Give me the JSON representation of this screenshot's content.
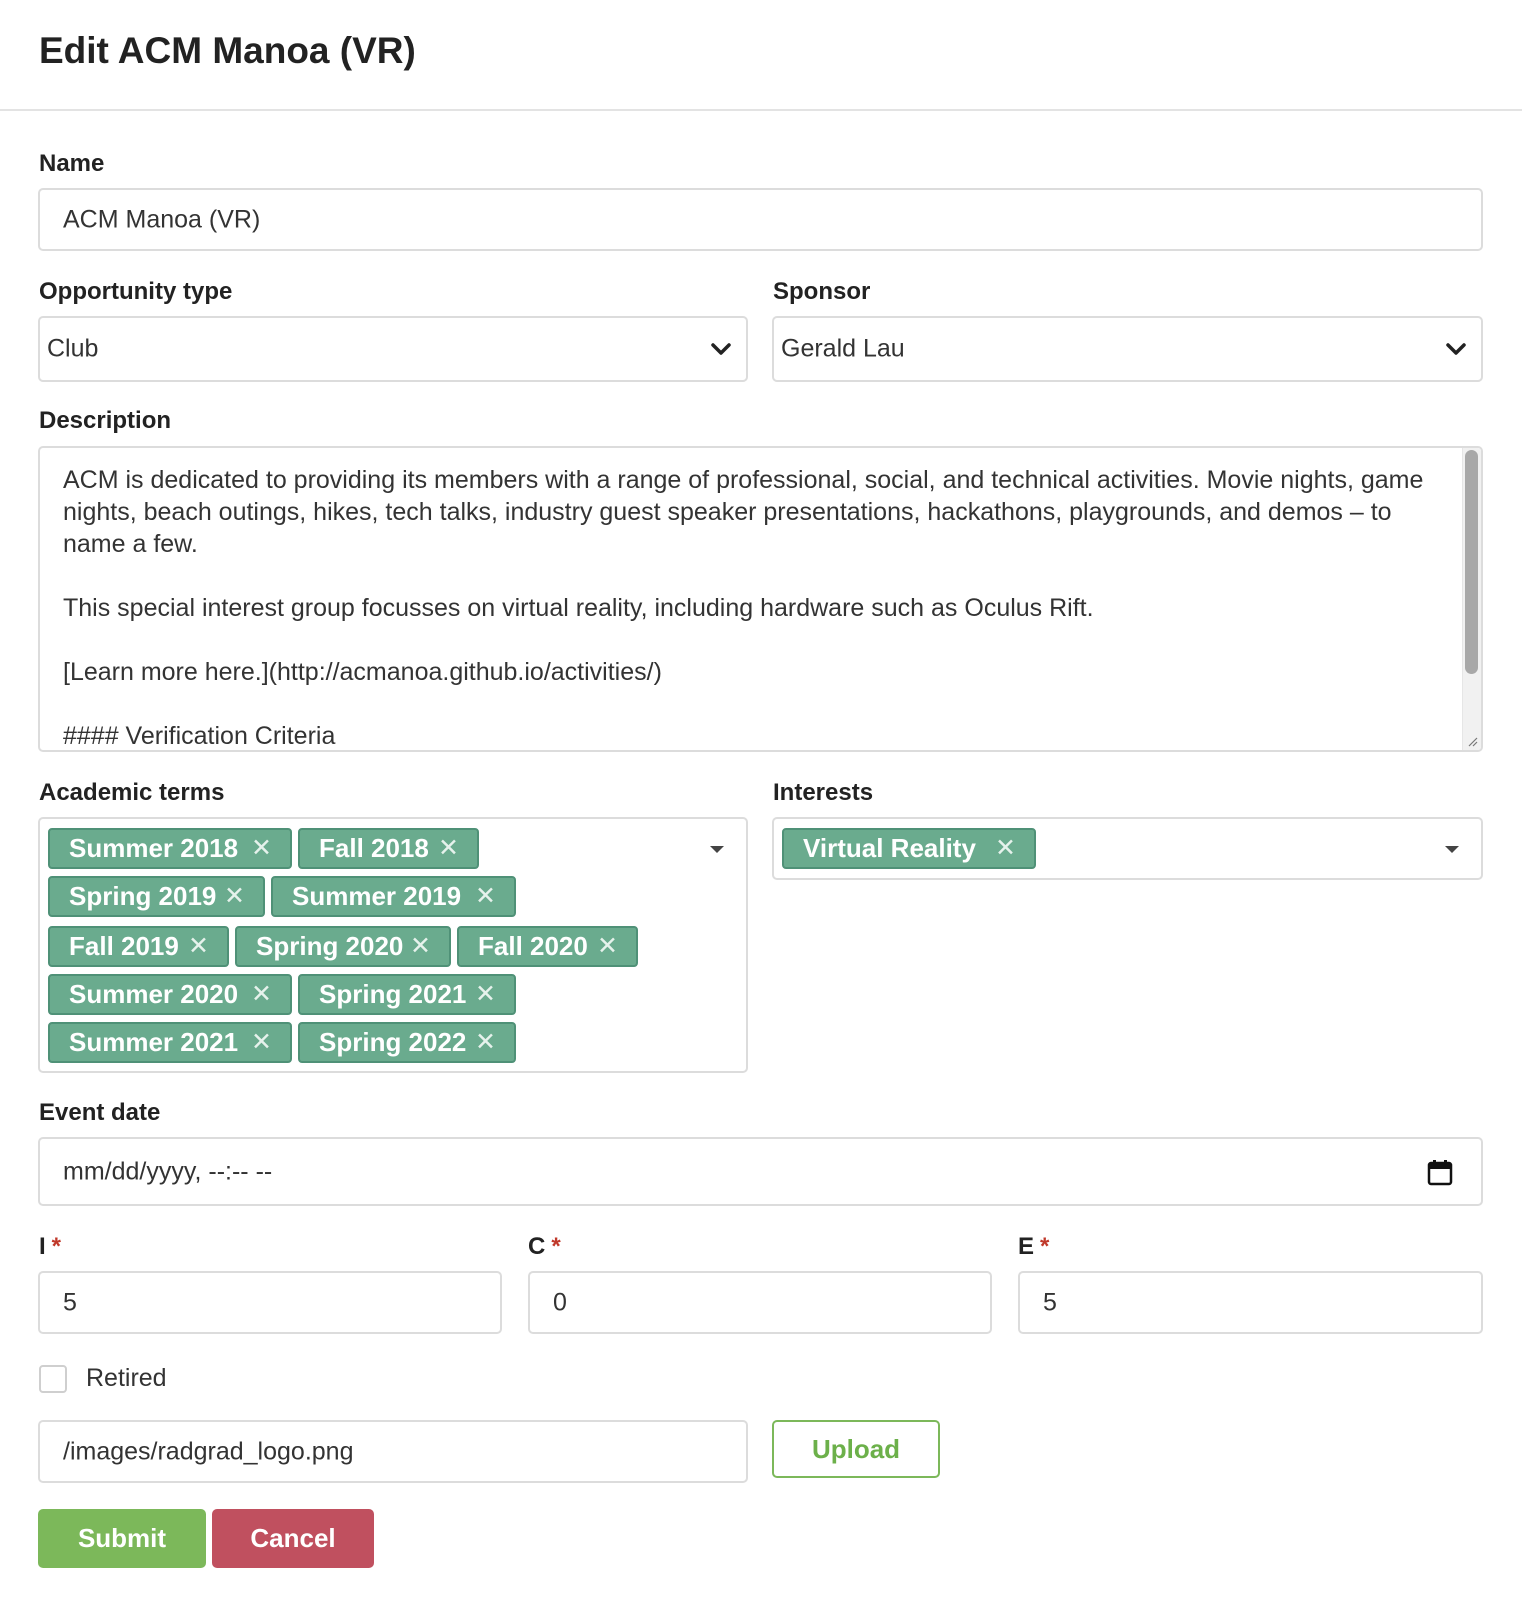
{
  "dialog": {
    "title": "Edit ACM Manoa (VR)"
  },
  "name": {
    "label": "Name",
    "value": "ACM Manoa (VR)"
  },
  "opportunity_type": {
    "label": "Opportunity type",
    "value": "Club"
  },
  "sponsor": {
    "label": "Sponsor",
    "value": "Gerald Lau"
  },
  "description": {
    "label": "Description",
    "value": "ACM is dedicated to providing its members with a range of professional, social, and technical activities. Movie nights, game nights, beach outings, hikes, tech talks, industry guest speaker presentations, hackathons, playgrounds, and demos – to name a few.\n\nThis special interest group focusses on virtual reality, including hardware such as Oculus Rift.\n\n[Learn more here.](http://acmanoa.github.io/activities/)\n\n#### Verification Criteria"
  },
  "academic_terms": {
    "label": "Academic terms",
    "tags": [
      "Summer 2018",
      "Fall 2018",
      "Spring 2019",
      "Summer 2019",
      "Fall 2019",
      "Spring 2020",
      "Fall 2020",
      "Summer 2020",
      "Spring 2021",
      "Summer 2021",
      "Spring 2022"
    ]
  },
  "interests": {
    "label": "Interests",
    "tags": [
      "Virtual Reality"
    ]
  },
  "event_date": {
    "label": "Event date",
    "placeholder": "mm/dd/yyyy, --:-- --"
  },
  "ice": {
    "i": {
      "label": "I",
      "value": "5"
    },
    "c": {
      "label": "C",
      "value": "0"
    },
    "e": {
      "label": "E",
      "value": "5"
    },
    "required_mark": "*"
  },
  "retired": {
    "label": "Retired",
    "checked": false
  },
  "picture": {
    "value": "/images/radgrad_logo.png",
    "upload_label": "Upload"
  },
  "actions": {
    "submit_label": "Submit",
    "cancel_label": "Cancel"
  },
  "colors": {
    "tag": "#6aab8e",
    "submit": "#7cb85a",
    "cancel": "#c0505f",
    "required": "#c0392b"
  }
}
